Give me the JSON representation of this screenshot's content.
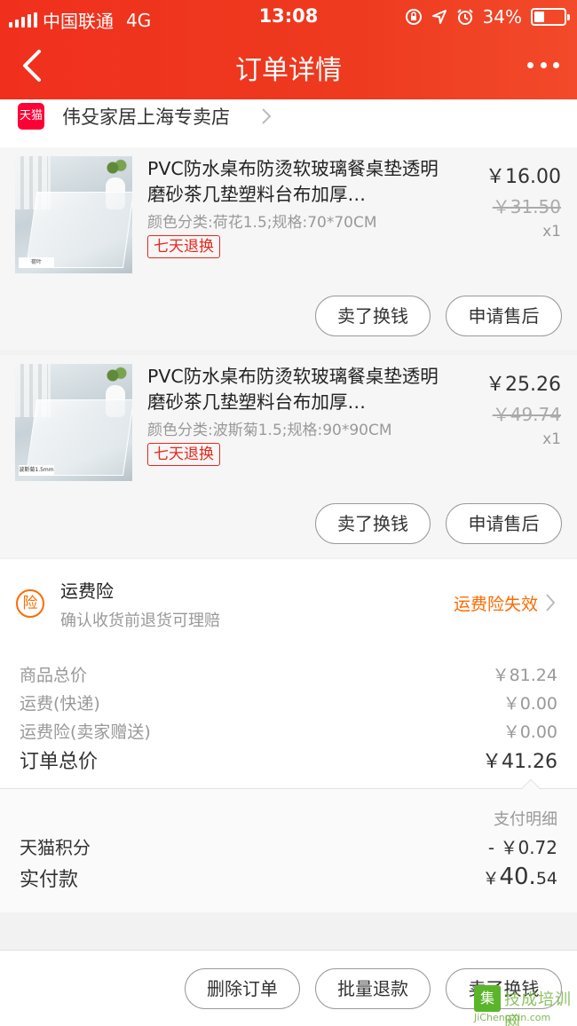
{
  "status_bar": {
    "carrier": "中国联通",
    "network": "4G",
    "time": "13:08",
    "battery": "34%",
    "battery_level": 0.34
  },
  "nav": {
    "title": "订单详情"
  },
  "store": {
    "badge": "天猫",
    "name": "伟殳家居上海专卖店"
  },
  "items": [
    {
      "title": "PVC防水桌布防烫软玻璃餐桌垫透明磨砂茶几垫塑料台布加厚…",
      "sku": "颜色分类:荷花1.5;规格:70*70CM",
      "badge": "七天退换",
      "price": "￥16.00",
      "original_price": "￥31.50",
      "quantity": "x1",
      "image_tag": "荷叶",
      "sell_label": "卖了换钱",
      "aftersale_label": "申请售后"
    },
    {
      "title": "PVC防水桌布防烫软玻璃餐桌垫透明磨砂茶几垫塑料台布加厚…",
      "sku": "颜色分类:波斯菊1.5;规格:90*90CM",
      "badge": "七天退换",
      "price": "￥25.26",
      "original_price": "￥49.74",
      "quantity": "x1",
      "image_tag": "波斯菊1.5mm",
      "sell_label": "卖了换钱",
      "aftersale_label": "申请售后"
    }
  ],
  "insurance": {
    "icon_text": "险",
    "title": "运费险",
    "description": "确认收货前退货可理赔",
    "status": "运费险失效"
  },
  "summary": {
    "goods_total_label": "商品总价",
    "goods_total": "￥81.24",
    "shipping_label": "运费(快递)",
    "shipping": "￥0.00",
    "shipping_insurance_label": "运费险(卖家赠送)",
    "shipping_insurance": "￥0.00",
    "order_total_label": "订单总价",
    "order_total": "￥41.26"
  },
  "payment": {
    "detail_label": "支付明细",
    "points_label": "天猫积分",
    "points_value": "- ￥0.72",
    "paid_label": "实付款",
    "paid_currency": "￥",
    "paid_integer": "40.",
    "paid_decimal": "54"
  },
  "bottom_actions": {
    "delete_label": "删除订单",
    "refund_label": "批量退款",
    "sell_label": "卖了换钱"
  },
  "watermark": {
    "logo": "集",
    "name": "技成培训网",
    "url": "JiChengXin.com"
  },
  "colors": {
    "header_red": "#f0301d",
    "badge_red": "#e6281e",
    "accent_orange": "#ff6a00",
    "tmall_red": "#ff0036"
  }
}
